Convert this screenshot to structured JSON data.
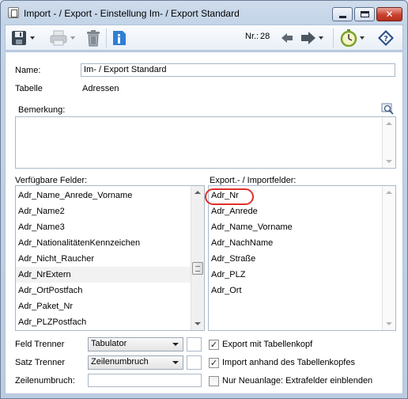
{
  "window": {
    "title": "Import - / Export - Einstellung Im- / Export Standard"
  },
  "toolbar": {
    "nr_label": "Nr.:",
    "nr_value": "28"
  },
  "form": {
    "name_label": "Name:",
    "name_value": "Im- / Export Standard",
    "tabelle_label": "Tabelle",
    "tabelle_value": "Adressen",
    "bemerkung_label": "Bemerkung:",
    "available_label": "Verfügbare Felder:",
    "available_fields": [
      "Adr_Name_Anrede_Vorname",
      "Adr_Name2",
      "Adr_Name3",
      "Adr_NationalitätenKennzeichen",
      "Adr_Nicht_Raucher",
      "Adr_NrExtern",
      "Adr_OrtPostfach",
      "Adr_Paket_Nr",
      "Adr_PLZPostfach"
    ],
    "selected_label": "Export.- / Importfelder:",
    "selected_fields": [
      "Adr_Nr",
      "Adr_Anrede",
      "Adr_Name_Vorname",
      "Adr_NachName",
      "Adr_Straße",
      "Adr_PLZ",
      "Adr_Ort"
    ],
    "feld_trenner_label": "Feld Trenner",
    "feld_trenner_value": "Tabulator",
    "satz_trenner_label": "Satz Trenner",
    "satz_trenner_value": "Zeilenumbruch",
    "zeilenumbruch_label": "Zeilenumbruch:",
    "export_header_label": "Export mit Tabellenkopf",
    "export_header_checked": true,
    "import_header_label": "Import anhand des Tabellenkopfes",
    "import_header_checked": true,
    "extra_fields_label": "Nur Neuanlage: Extrafelder einblenden",
    "extra_fields_checked": false
  }
}
